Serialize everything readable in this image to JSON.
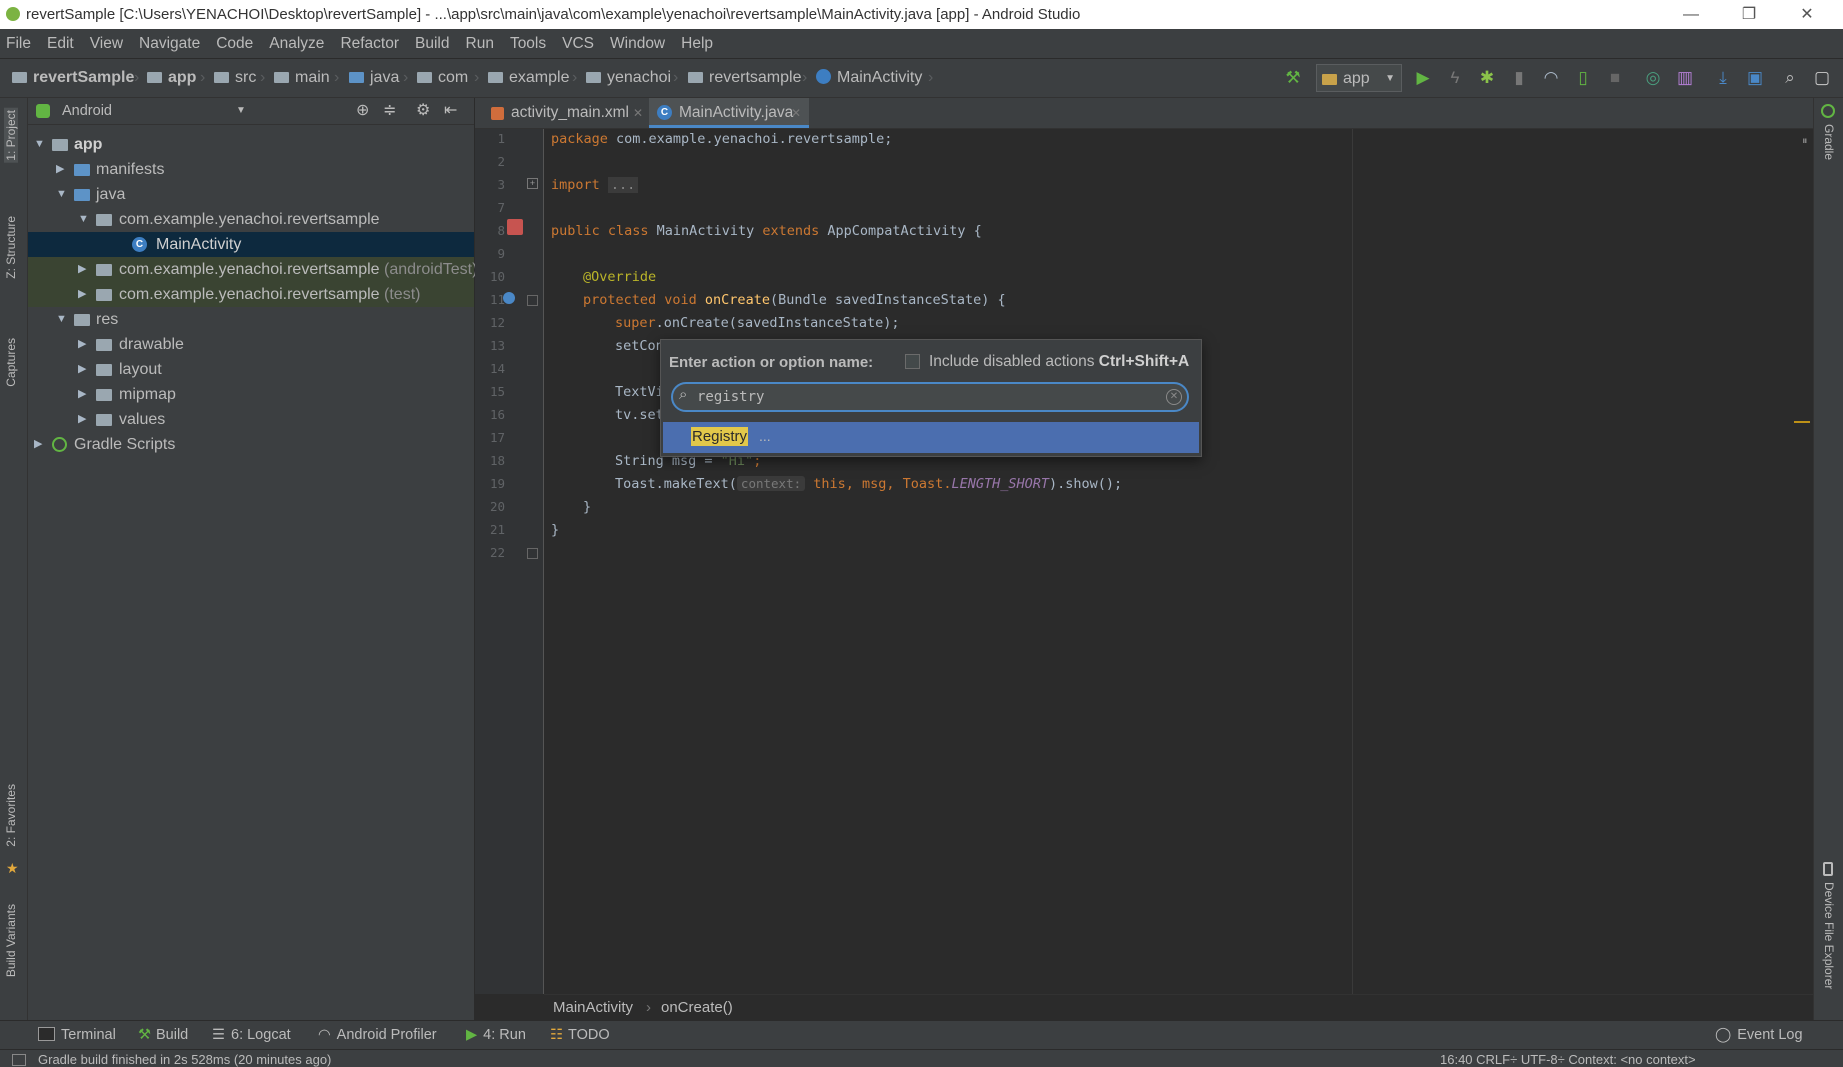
{
  "window": {
    "title": "revertSample [C:\\Users\\YENACHOI\\Desktop\\revertSample] - ...\\app\\src\\main\\java\\com\\example\\yenachoi\\revertsample\\MainActivity.java [app] - Android Studio",
    "min": "—",
    "max": "❐",
    "close": "✕"
  },
  "menu": [
    "File",
    "Edit",
    "View",
    "Navigate",
    "Code",
    "Analyze",
    "Refactor",
    "Build",
    "Run",
    "Tools",
    "VCS",
    "Window",
    "Help"
  ],
  "nav": {
    "crumbs": [
      "revertSample",
      "app",
      "src",
      "main",
      "java",
      "com",
      "example",
      "yenachoi",
      "revertsample",
      "MainActivity"
    ],
    "run_config": "app"
  },
  "left_stripe": {
    "project": "1: Project",
    "structure": "Z: Structure",
    "captures": "Captures",
    "favorites": "2: Favorites",
    "build_variants": "Build Variants"
  },
  "right_stripe": {
    "gradle": "Gradle",
    "device_explorer": "Device File Explorer"
  },
  "project": {
    "view_mode": "Android",
    "tree": [
      {
        "label": "app",
        "bold": true
      },
      {
        "label": "manifests"
      },
      {
        "label": "java"
      },
      {
        "label": "com.example.yenachoi.revertsample"
      },
      {
        "label": "MainActivity"
      },
      {
        "label": "com.example.yenachoi.revertsample",
        "suffix": "(androidTest)"
      },
      {
        "label": "com.example.yenachoi.revertsample",
        "suffix": "(test)"
      },
      {
        "label": "res"
      },
      {
        "label": "drawable"
      },
      {
        "label": "layout"
      },
      {
        "label": "mipmap"
      },
      {
        "label": "values"
      },
      {
        "label": "Gradle Scripts"
      }
    ]
  },
  "editor": {
    "tabs": [
      {
        "label": "activity_main.xml"
      },
      {
        "label": "MainActivity.java",
        "active": true
      }
    ],
    "line_numbers": [
      "1",
      "2",
      "3",
      "7",
      "8",
      "9",
      "10",
      "11",
      "12",
      "13",
      "14",
      "15",
      "16",
      "17",
      "18",
      "19",
      "20",
      "21",
      "22"
    ],
    "code": {
      "l1_kw": "package",
      "l1_rest": " com.example.yenachoi.revertsample;",
      "l3_kw": "import",
      "l3_fold": "...",
      "l8_a": "public class",
      "l8_b": " MainActivity ",
      "l8_c": "extends",
      "l8_d": " AppCompatActivity {",
      "l10": "@Override",
      "l11_kw": "protected void",
      "l11_fn": " onCreate",
      "l11_rest": "(Bundle savedInstanceState) {",
      "l12_kw": "super",
      "l12_rest": ".onCreate(savedInstanceState);",
      "l13": "setCon",
      "l15": "TextVi",
      "l16": "tv.set",
      "l18_a": "String msg = ",
      "l18_str": "\"Hi\"",
      "l18_end": ";",
      "l19_a": "Toast.makeText(",
      "l19_hint": "context:",
      "l19_kw": " this",
      "l19_b": ", msg, Toast.",
      "l19_const": "LENGTH_SHORT",
      "l19_c": ").show();",
      "l20": "}",
      "l21": "}"
    },
    "breadcrumb": {
      "cls": "MainActivity",
      "method": "onCreate()"
    }
  },
  "popup": {
    "label": "Enter action or option name:",
    "checkbox_label": "Include disabled actions",
    "shortcut": "Ctrl+Shift+A",
    "search_value": "registry",
    "result_match": "Registry",
    "result_rest": "..."
  },
  "bottom_tabs": {
    "terminal": "Terminal",
    "build": "Build",
    "logcat": "6: Logcat",
    "profiler": "Android Profiler",
    "run": "4: Run",
    "todo": "TODO",
    "event_log": "Event Log"
  },
  "status": {
    "message": "Gradle build finished in 2s 528ms (20 minutes ago)",
    "right": "16:40   CRLF÷   UTF-8÷   Context: <no context>"
  },
  "colors": {
    "accent": "#4a88c7",
    "selection": "#4b6eaf",
    "match_highlight": "#e2c84a"
  }
}
